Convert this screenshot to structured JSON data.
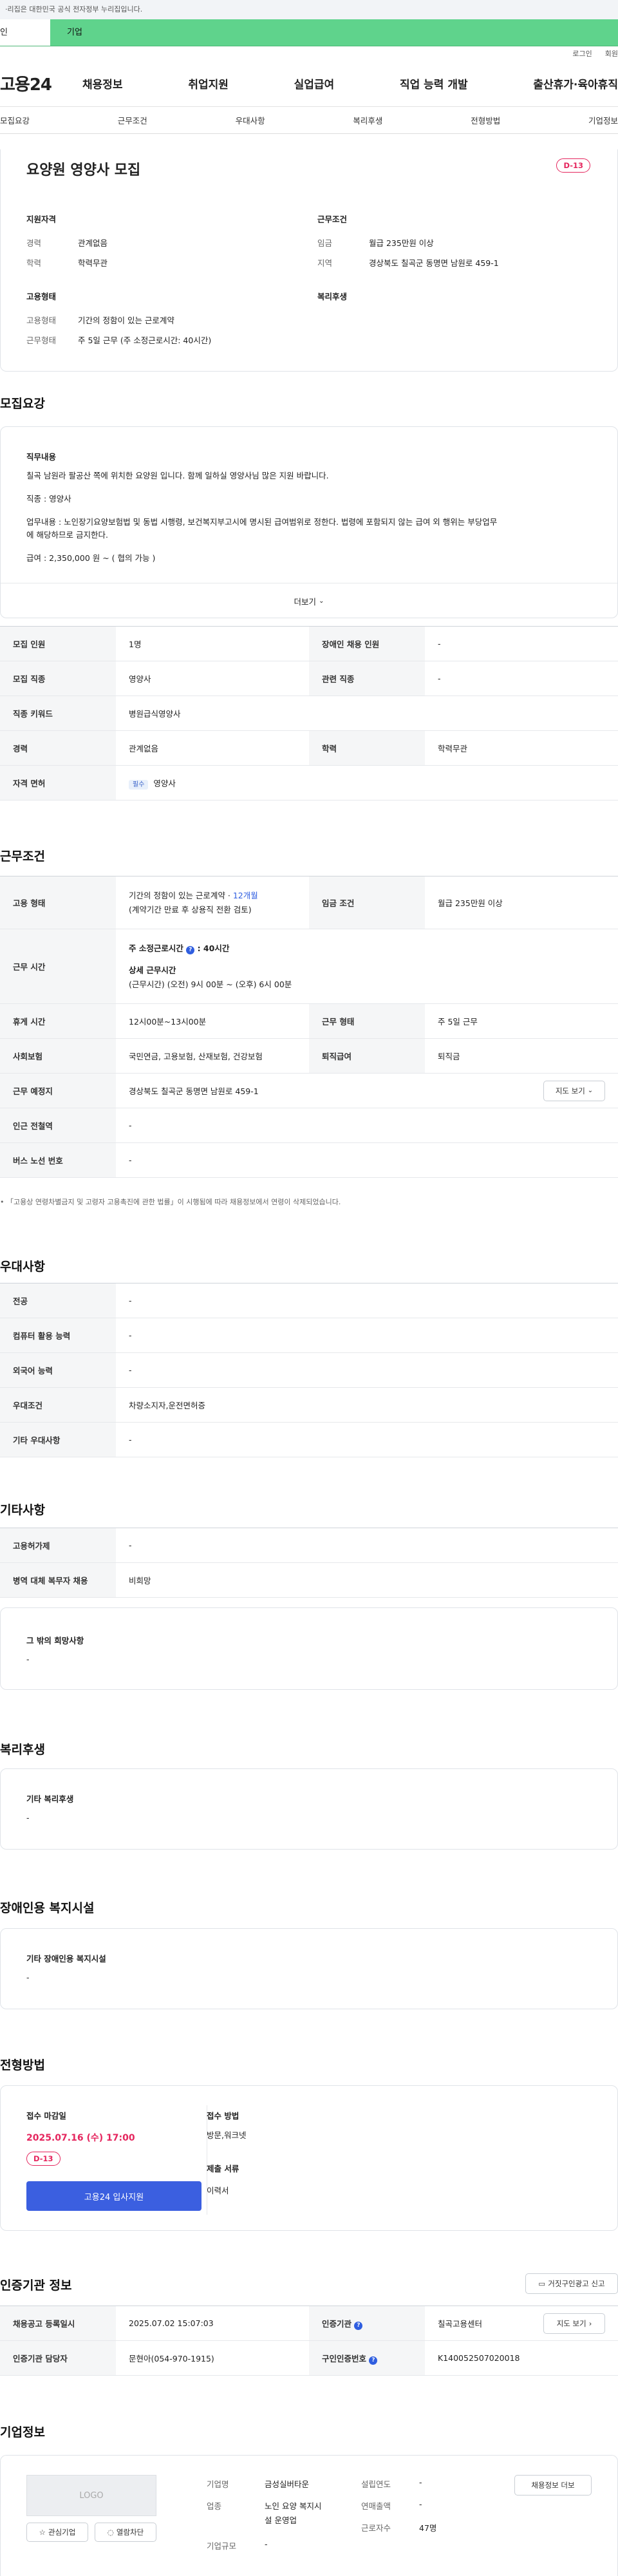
{
  "gov_bar": "·리집은 대한민국 공식 전자정부 누리집입니다.",
  "tabs": [
    "인",
    "기업"
  ],
  "util": [
    "로그인",
    "회원"
  ],
  "logo": "고용24",
  "gnb": [
    "채용정보",
    "취업지원",
    "실업급여",
    "직업 능력 개발",
    "출산휴가·육아휴직"
  ],
  "snb": [
    "모집요강",
    "근무조건",
    "우대사항",
    "복리후생",
    "전형방법",
    "기업정보"
  ],
  "summary": {
    "title": "요양원 영양사 모집",
    "dday": "D-13",
    "qual_title": "지원자격",
    "qual": [
      {
        "k": "경력",
        "v": "관계없음"
      },
      {
        "k": "학력",
        "v": "학력무관"
      }
    ],
    "cond_title": "근무조건",
    "cond": [
      {
        "k": "임금",
        "v": "월급 235만원 이상"
      },
      {
        "k": "지역",
        "v": "경상북도 칠곡군 동명면 남원로 459-1"
      }
    ],
    "emp_title": "고용형태",
    "emp": [
      {
        "k": "고용형태",
        "v": "기간의 정함이 있는 근로계약"
      },
      {
        "k": "근무형태",
        "v": "주 5일 근무 (주 소정근로시간: 40시간)"
      }
    ],
    "welfare_title": "복리후생"
  },
  "recruit": {
    "title": "모집요강",
    "job_title": "직무내용",
    "lines": [
      "칠곡 남원라 팔공산 쪽에 위치한 요양원 입니다. 함께 일하실 영양사님 많은 지원 바랍니다.",
      "직종 : 영양사",
      "업무내용 : 노인장기요양보험법 및 동법 시행령, 보건복지부고시에 명시된 급여범위로 정한다. 법령에 포함되지 않는 급여 외 행위는 부당업무",
      "에 해당하므로 금지한다.",
      "급여 : 2,350,000 원 ~ ( 협의 가능 )"
    ],
    "more": "더보기",
    "rows": [
      {
        "h1": "모집 인원",
        "v1": "1명",
        "h2": "장애인 채용 인원",
        "v2": "-"
      },
      {
        "h1": "모집 직종",
        "v1": "영양사",
        "h2": "관련 직종",
        "v2": "-"
      },
      {
        "h1": "직종 키워드",
        "v1": "병원급식영양사"
      },
      {
        "h1": "경력",
        "v1": "관계없음",
        "h2": "학력",
        "v2": "학력무관"
      },
      {
        "h1": "자격 면허",
        "chip": "필수",
        "v1": "영양사"
      }
    ]
  },
  "work": {
    "title": "근무조건",
    "emp_h": "고용 형태",
    "emp_v1": "기간의 정함이 있는 근로계약 · ",
    "emp_v1b": "12개월",
    "emp_v2": "(계약기간 만료 후 상용직 전환 검토)",
    "wage_h": "임금 조건",
    "wage_v": "월급 235만원 이상",
    "time_h": "근무 시간",
    "time_a": "주 소정근로시간",
    "time_a2": ": 40시간",
    "time_b": "상세 근무시간",
    "time_c": "(근무시간) (오전) 9시 00분 ~ (오후) 6시 00분",
    "rows": [
      {
        "h1": "휴게 시간",
        "v1": "12시00분~13시00분",
        "h2": "근무 형태",
        "v2": "주 5일 근무"
      },
      {
        "h1": "사회보험",
        "v1": "국민연금, 고용보험, 산재보험, 건강보험",
        "h2": "퇴직급여",
        "v2": "퇴직금"
      }
    ],
    "place_h": "근무 예정지",
    "place_v": "경상북도 칠곡군 동명면 남원로 459-1",
    "map": "지도 보기",
    "sub": "인근 전철역",
    "bus": "버스 노선 번호",
    "dash": "-",
    "note": "「고용상 연령차별금지 및 고령자 고용촉진에 관한 법률」이 시행됨에 따라 채용정보에서 연령이 삭제되었습니다."
  },
  "pref": {
    "title": "우대사항",
    "rows": [
      {
        "h": "전공",
        "v": "-"
      },
      {
        "h": "컴퓨터 활용 능력",
        "v": "-"
      },
      {
        "h": "외국어 능력",
        "v": "-"
      },
      {
        "h": "우대조건",
        "v": "차량소지자,운전면허증"
      },
      {
        "h": "기타 우대사항",
        "v": "-"
      }
    ]
  },
  "etc": {
    "title": "기타사항",
    "rows": [
      {
        "h": "고용허가제",
        "v": "-"
      },
      {
        "h": "병역 대체 복무자 채용",
        "v": "비희망"
      }
    ],
    "box_title": "그 밖의 희망사항",
    "box_v": "-"
  },
  "benefit": {
    "title": "복리후생",
    "box_title": "기타 복리후생",
    "box_v": "-"
  },
  "disabled": {
    "title": "장애인용 복지시설",
    "box_title": "기타 장애인용 복지시설",
    "box_v": "-"
  },
  "apply": {
    "title": "전형방법",
    "deadline_h": "접수 마감일",
    "deadline": "2025.07.16 (수) 17:00",
    "dday": "D-13",
    "apply_btn": "고용24 입사지원",
    "method_h": "접수 방법",
    "method_v": "방문,워크넷",
    "docs_h": "제출 서류",
    "docs_v": "이력서"
  },
  "cert": {
    "title": "인증기관 정보",
    "report": "거짓구인광고 신고",
    "r1": {
      "h1": "채용공고 등록일시",
      "v1": "2025.07.02 15:07:03",
      "h2": "인증기관",
      "v2": "칠곡고용센터",
      "btn": "지도 보기"
    },
    "r2": {
      "h1": "인증기관 담당자",
      "v1": "문현아(054-970-1915)",
      "h2": "구인인증번호",
      "v2": "K140052507020018"
    }
  },
  "company": {
    "title": "기업정보",
    "logo": "LOGO",
    "fav": "관심기업",
    "block": "열람차단",
    "name_h": "기업명",
    "name_v": "금성실버타운",
    "biz_h": "업종",
    "biz_v1": "노인 요양 복지시",
    "biz_v2": "설 운영업",
    "size_h": "기업규모",
    "size_v": "-",
    "year_h": "설립연도",
    "year_v": "-",
    "sales_h": "연매출액",
    "sales_v": "-",
    "emp_h": "근로자수",
    "emp_v": "47명",
    "more": "채용정보 더보"
  }
}
